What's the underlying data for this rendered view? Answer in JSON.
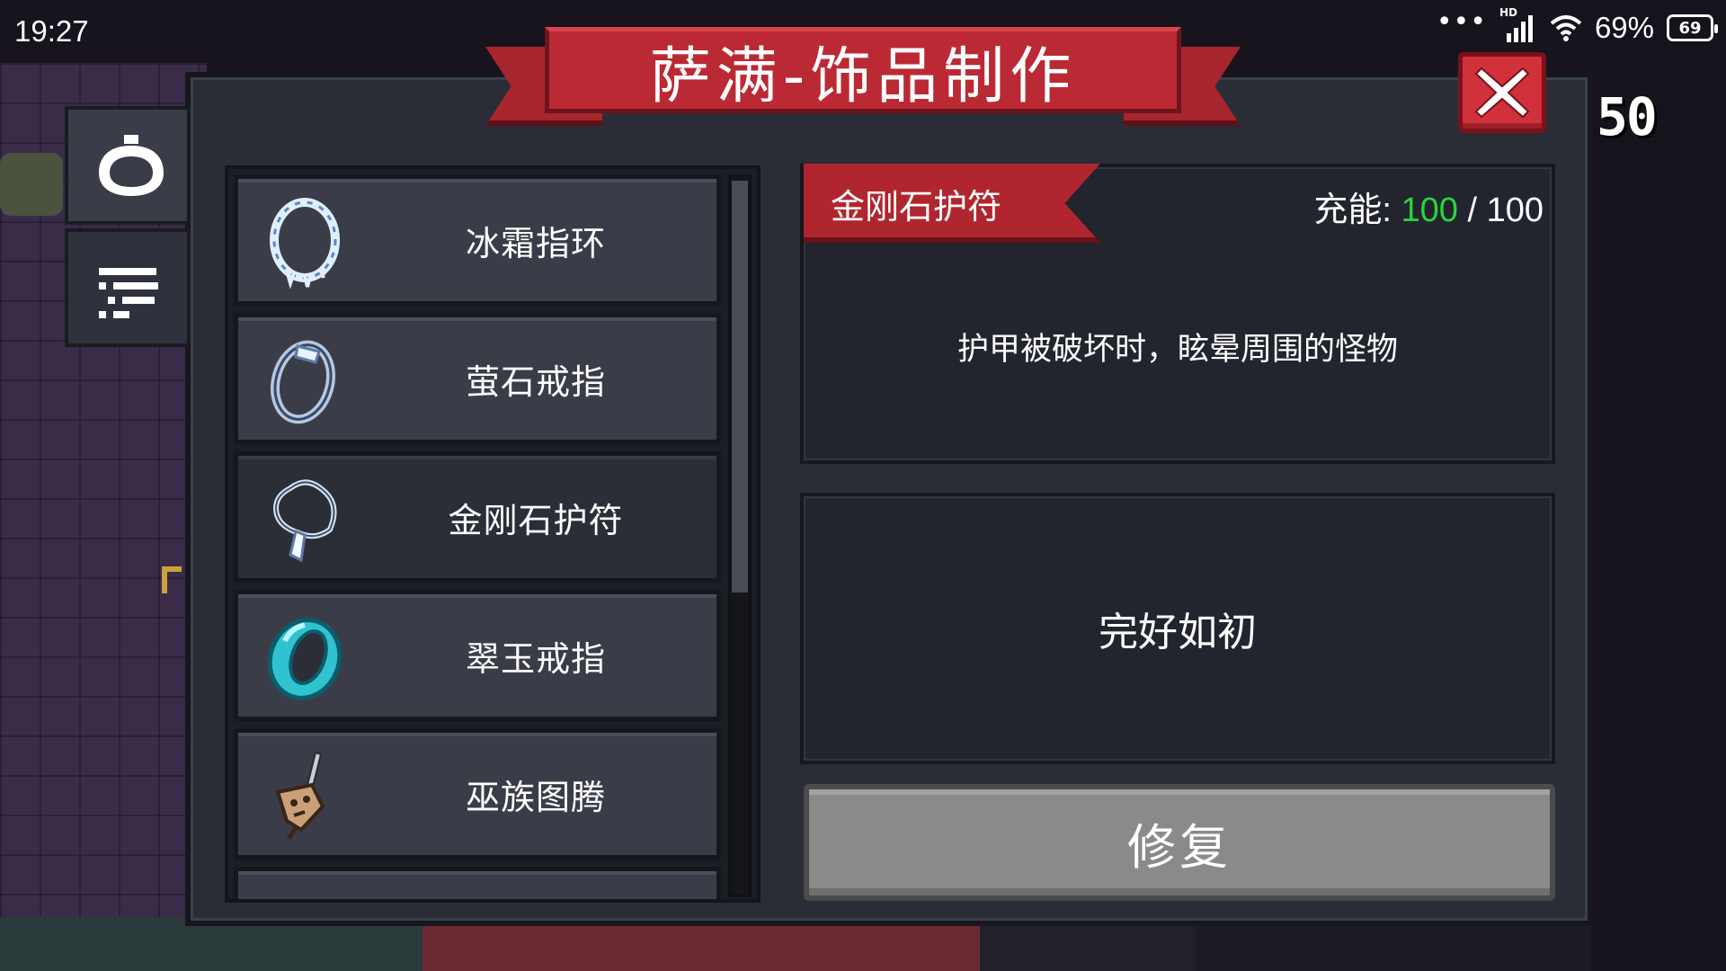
{
  "status_bar": {
    "time": "19:27",
    "network_badge": "HD",
    "battery_percent": "69%",
    "battery_level": "69"
  },
  "hud": {
    "coin_count": "50"
  },
  "panel": {
    "title": "萨满-饰品制作"
  },
  "side_tabs": [
    {
      "icon": "ring-icon",
      "active": true
    },
    {
      "icon": "list-filter-icon",
      "active": false
    }
  ],
  "items": [
    {
      "label": "冰霜指环",
      "icon": "frost-ring-icon"
    },
    {
      "label": "萤石戒指",
      "icon": "fluorite-ring-icon"
    },
    {
      "label": "金刚石护符",
      "icon": "diamond-amulet-icon",
      "selected": true
    },
    {
      "label": "翠玉戒指",
      "icon": "jade-ring-icon"
    },
    {
      "label": "巫族图腾",
      "icon": "witch-totem-icon"
    }
  ],
  "details": {
    "name": "金刚石护符",
    "charge_label": "充能:",
    "charge_current": "100",
    "charge_max": "/ 100",
    "description": "护甲被破坏时，眩晕周围的怪物",
    "state": "完好如初",
    "action_label": "修复"
  },
  "colors": {
    "accent_red": "#bb2a34",
    "charge_green": "#29d43d",
    "panel_bg": "#2a2d36"
  }
}
